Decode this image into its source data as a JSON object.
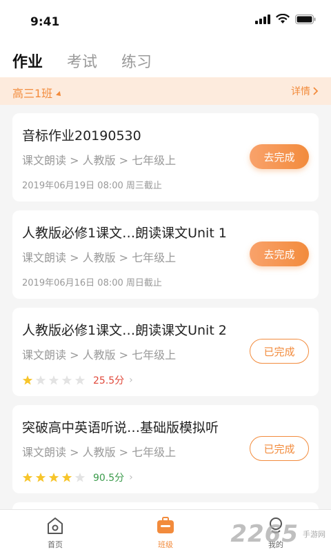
{
  "status_bar": {
    "time": "9:41"
  },
  "tabs": [
    {
      "label": "作业",
      "active": true
    },
    {
      "label": "考试",
      "active": false
    },
    {
      "label": "练习",
      "active": false
    }
  ],
  "class_bar": {
    "class_name": "高三1班",
    "detail_label": "详情"
  },
  "assignments": [
    {
      "title": "音标作业20190530",
      "subtitle": "课文朗读 > 人教版 > 七年级上",
      "deadline": "2019年06月19日 08:00 周三截止",
      "button": "去完成",
      "state": "todo"
    },
    {
      "title": "人教版必修1课文…朗读课文Unit 1",
      "subtitle": "课文朗读 > 人教版 > 七年级上",
      "deadline": "2019年06月16日 08:00 周日截止",
      "button": "去完成",
      "state": "todo"
    },
    {
      "title": "人教版必修1课文…朗读课文Unit 2",
      "subtitle": "课文朗读 > 人教版 > 七年级上",
      "rating": 1,
      "score": "25.5分",
      "score_color": "#e0483a",
      "button": "已完成",
      "state": "done"
    },
    {
      "title": "突破高中英语听说…基础版模拟听",
      "subtitle": "课文朗读 > 人教版 > 七年级上",
      "rating": 4,
      "score": "90.5分",
      "score_color": "#3a9a4a",
      "button": "已完成",
      "state": "done"
    }
  ],
  "bottom_nav": [
    {
      "label": "首页",
      "icon": "home-icon",
      "active": false
    },
    {
      "label": "班级",
      "icon": "class-icon",
      "active": true
    },
    {
      "label": "我的",
      "icon": "profile-icon",
      "active": false
    }
  ],
  "watermark": {
    "brand": "2265",
    "site": "手游网"
  },
  "colors": {
    "accent": "#f28b3c",
    "star_on": "#f7c52b",
    "star_off": "#e3e3e3"
  }
}
